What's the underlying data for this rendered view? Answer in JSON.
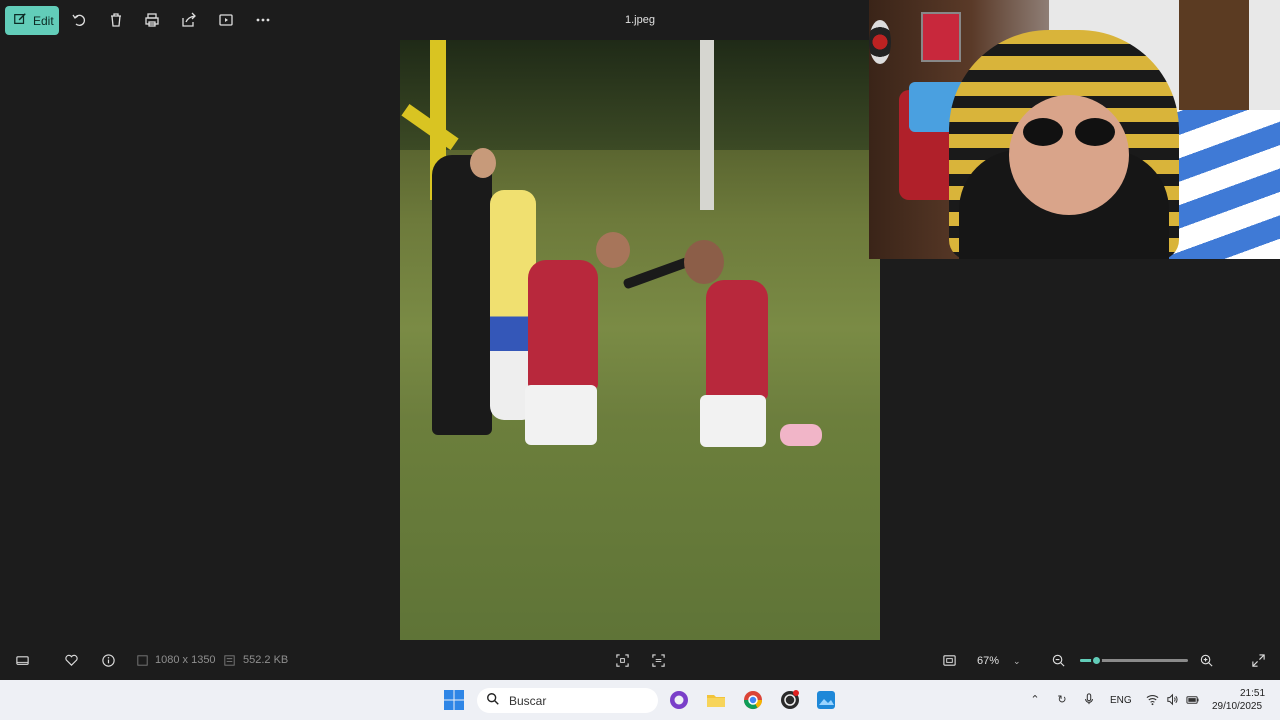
{
  "toolbar": {
    "edit_label": "Edit",
    "file_name": "1.jpeg",
    "icons": [
      "edit-icon",
      "rotate-icon",
      "delete-icon",
      "print-icon",
      "share-icon",
      "slideshow-icon",
      "more-icon"
    ]
  },
  "info": {
    "dimensions": "1080 x 1350",
    "file_size": "552.2 KB",
    "zoom": "67%",
    "zoom_level": 0.15
  },
  "taskbar": {
    "search_placeholder": "Buscar",
    "language": "ENG",
    "time": "21:51",
    "date": "29/10/2025"
  },
  "colors": {
    "accent": "#62cdb9",
    "background": "#1c1c1c",
    "taskbar": "#eef0f5"
  }
}
